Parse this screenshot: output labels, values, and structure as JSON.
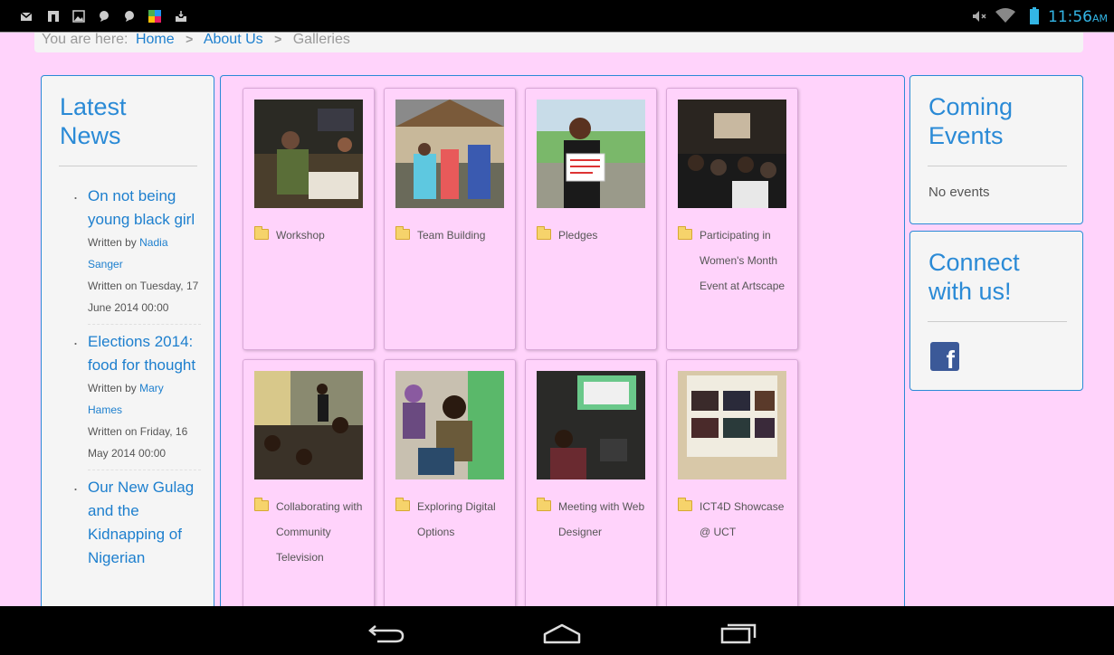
{
  "status_bar": {
    "notification_icons": [
      "gmail-icon",
      "flipboard-icon",
      "gallery-icon",
      "chat-icon",
      "chat-icon",
      "app-icon",
      "inbox-icon"
    ],
    "status_icons": [
      "mute-icon",
      "wifi-icon",
      "battery-icon"
    ],
    "time": "11:56",
    "ampm": "AM"
  },
  "breadcrumb": {
    "prefix": "You are here:",
    "items": [
      "Home",
      "About Us",
      "Galleries"
    ]
  },
  "latest_news": {
    "title_line1": "Latest",
    "title_line2": "News",
    "items": [
      {
        "title": "On not being young black girl",
        "written_by_label": "Written by",
        "author": "Nadia Sanger",
        "date": "Written on Tuesday, 17 June 2014 00:00"
      },
      {
        "title": "Elections 2014: food for thought",
        "written_by_label": "Written by",
        "author": "Mary Hames",
        "date": "Written on Friday, 16 May 2014 00:00"
      },
      {
        "title": "Our New Gulag and the Kidnapping of Nigerian",
        "written_by_label": "",
        "author": "",
        "date": ""
      }
    ]
  },
  "gallery": {
    "cards": [
      {
        "label": "Workshop",
        "photo": "workshop-photo"
      },
      {
        "label": "Team Building",
        "photo": "team-building-photo"
      },
      {
        "label": "Pledges",
        "photo": "pledges-photo"
      },
      {
        "label": "Participating in Women's Month Event at Artscape",
        "photo": "womens-month-photo"
      },
      {
        "label": "Collaborating with Community Television",
        "photo": "community-tv-photo"
      },
      {
        "label": "Exploring Digital Options",
        "photo": "digital-options-photo"
      },
      {
        "label": "Meeting with Web Designer",
        "photo": "web-designer-photo"
      },
      {
        "label": "ICT4D Showcase @ UCT",
        "photo": "ict4d-showcase-photo"
      }
    ]
  },
  "coming_events": {
    "title_line1": "Coming",
    "title_line2": "Events",
    "empty_text": "No events"
  },
  "connect": {
    "title_line1": "Connect",
    "title_line2": "with us!",
    "facebook_icon": "facebook-icon"
  },
  "nav_bar": {
    "buttons": [
      "back-icon",
      "home-icon",
      "recent-apps-icon"
    ]
  },
  "colors": {
    "page_background": "#ffd3fb",
    "accent_blue": "#2a8ad6",
    "link_blue": "#1d7fce",
    "status_time": "#33b5e5",
    "facebook_blue": "#3b5998"
  }
}
